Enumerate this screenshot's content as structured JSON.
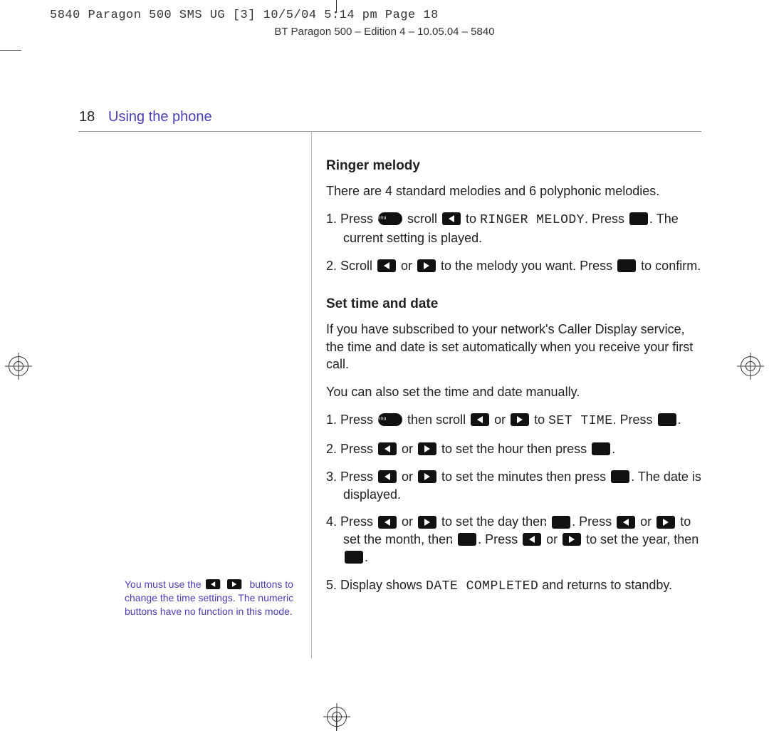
{
  "print_header": "5840 Paragon 500 SMS UG [3]  10/5/04  5:14 pm  Page 18",
  "edition_line": "BT Paragon 500 – Edition 4 – 10.05.04 – 5840",
  "page_number": "18",
  "section_title": "Using the phone",
  "ringer": {
    "heading": "Ringer melody",
    "intro": "There are 4 standard melodies and 6 polyphonic melodies.",
    "step1a": "Press ",
    "step1b": " scroll ",
    "step1c": " to ",
    "step1_menu": "RINGER MELODY",
    "step1d": ". Press ",
    "step1e": ". The current setting is played.",
    "step2a": "Scroll ",
    "step2b": " or ",
    "step2c": " to the melody you want. Press ",
    "step2d": " to confirm."
  },
  "settime": {
    "heading": "Set time and date",
    "intro1": "If you have subscribed to your network's Caller Display service, the time and date is set automatically when you receive your first call.",
    "intro2": "You can also set the time and date manually.",
    "s1a": "Press ",
    "s1b": " then scroll ",
    "s1c": " or ",
    "s1d": " to ",
    "s1_menu": "SET TIME",
    "s1e": ". Press ",
    "s1f": ".",
    "s2a": "Press ",
    "s2b": " or ",
    "s2c": " to set the hour then press ",
    "s2d": ".",
    "s3a": "Press ",
    "s3b": " or ",
    "s3c": " to set the minutes then press ",
    "s3d": ". The date is displayed.",
    "s4a": "Press ",
    "s4b": " or ",
    "s4c": " to set the day then ",
    "s4d": ". Press ",
    "s4e": " or ",
    "s4f": " to set the month, then ",
    "s4g": ". Press ",
    "s4h": " or ",
    "s4i": " to set the year, then ",
    "s4j": ".",
    "s5a": "Display shows ",
    "s5_menu": "DATE COMPLETED",
    "s5b": " and returns to standby."
  },
  "sidenote": {
    "a": "You must use the ",
    "b": " buttons to change the time settings. The numeric buttons have no function in this mode."
  }
}
